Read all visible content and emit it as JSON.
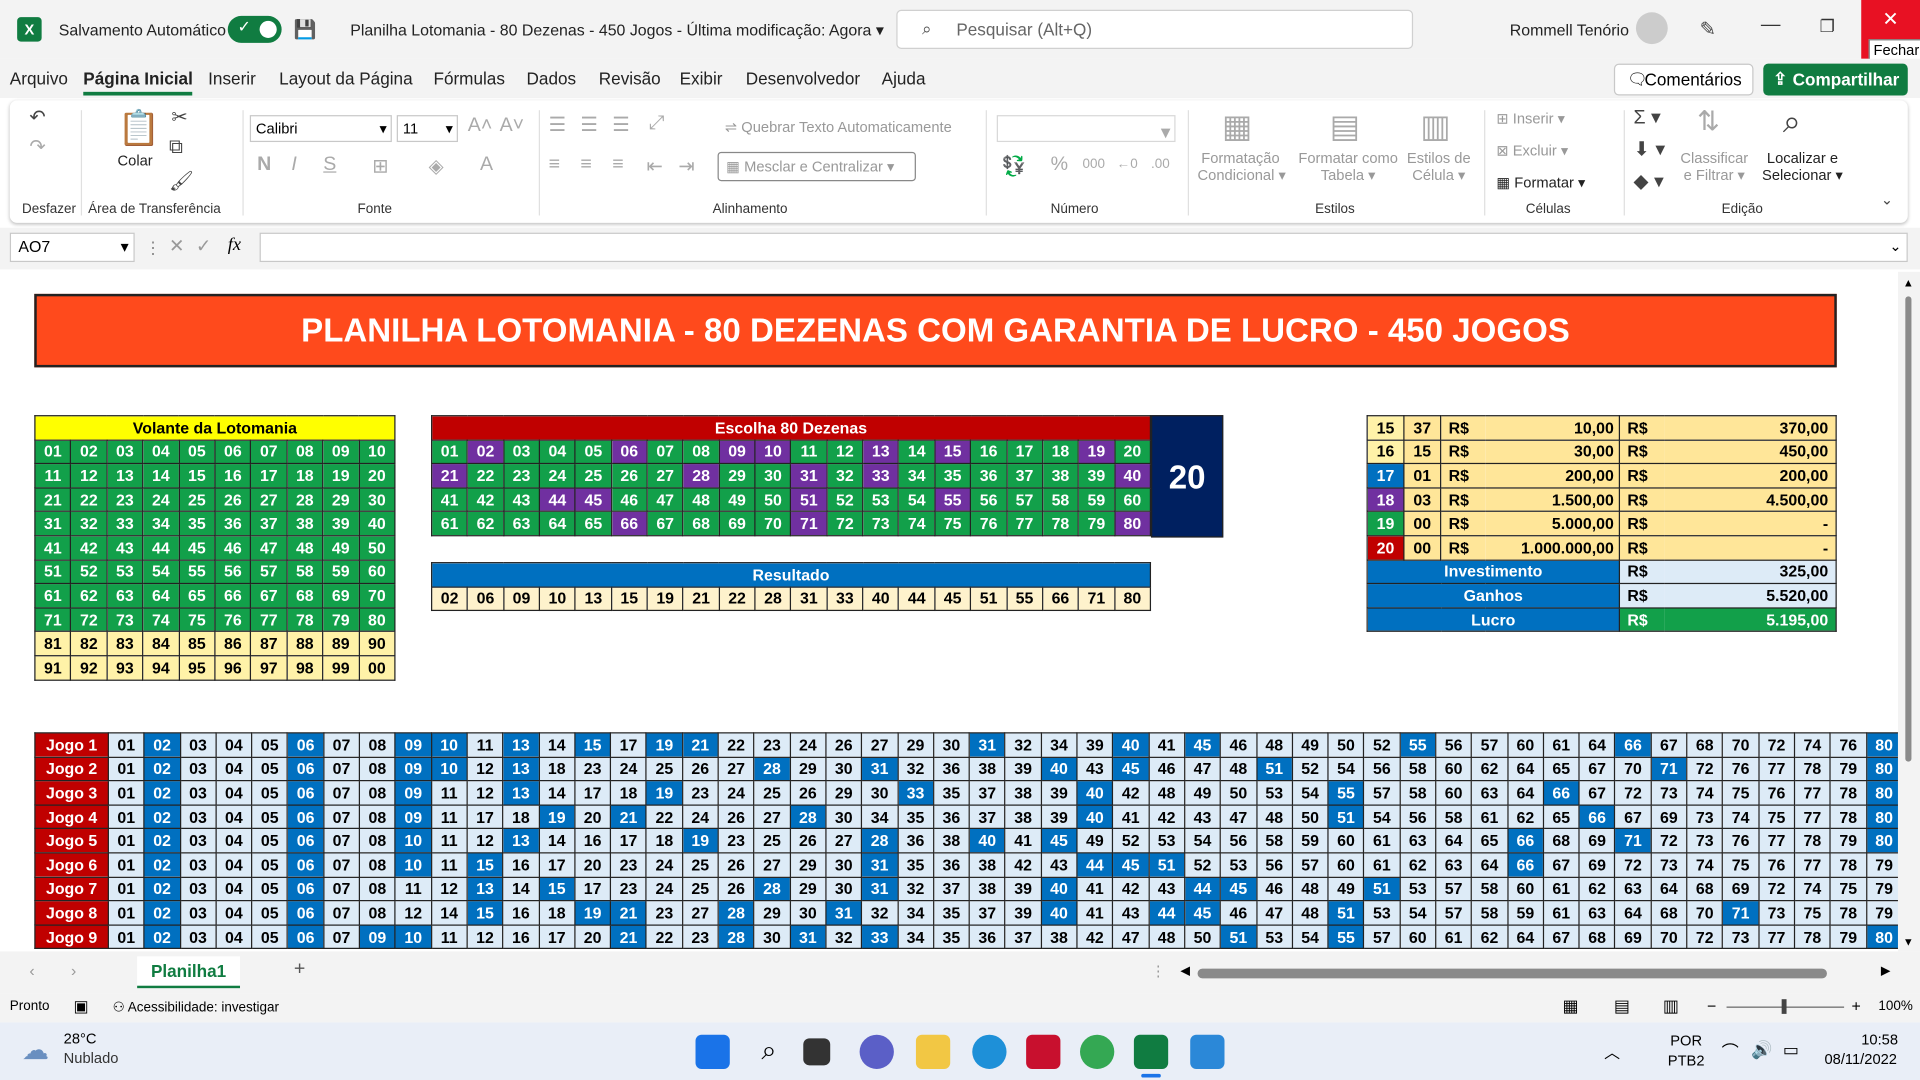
{
  "window": {
    "autosave_label": "Salvamento Automático",
    "file_title": "Planilha Lotomania - 80 Dezenas - 450 Jogos",
    "modified": "Última modificação: Agora",
    "search_placeholder": "Pesquisar (Alt+Q)",
    "user": "Rommell Tenório",
    "close_tooltip": "Fechar"
  },
  "menu": [
    "Arquivo",
    "Página Inicial",
    "Inserir",
    "Layout da Página",
    "Fórmulas",
    "Dados",
    "Revisão",
    "Exibir",
    "Desenvolvedor",
    "Ajuda"
  ],
  "comments_label": "Comentários",
  "share_label": "Compartilhar",
  "ribbon": {
    "paste": "Colar",
    "font_name": "Calibri",
    "font_size": "11",
    "wrap": "Quebrar Texto Automaticamente",
    "merge": "Mesclar e Centralizar",
    "cond_fmt_1": "Formatação",
    "cond_fmt_2": "Condicional",
    "fmt_table_1": "Formatar como",
    "fmt_table_2": "Tabela",
    "cell_styles_1": "Estilos de",
    "cell_styles_2": "Célula",
    "insert": "Inserir",
    "delete": "Excluir",
    "format": "Formatar",
    "sort_1": "Classificar",
    "sort_2": "e Filtrar",
    "find_1": "Localizar e",
    "find_2": "Selecionar",
    "groups": {
      "undo": "Desfazer",
      "clipboard": "Área de Transferência",
      "font": "Fonte",
      "align": "Alinhamento",
      "number": "Número",
      "styles": "Estilos",
      "cells": "Células",
      "edit": "Edição"
    }
  },
  "formula": {
    "namebox": "AO7",
    "fx": "fx"
  },
  "banner": "PLANILHA LOTOMANIA - 80 DEZENAS COM GARANTIA DE LUCRO - 450 JOGOS",
  "volante": {
    "title": "Volante da Lotomania",
    "rows": [
      [
        "01",
        "02",
        "03",
        "04",
        "05",
        "06",
        "07",
        "08",
        "09",
        "10"
      ],
      [
        "11",
        "12",
        "13",
        "14",
        "15",
        "16",
        "17",
        "18",
        "19",
        "20"
      ],
      [
        "21",
        "22",
        "23",
        "24",
        "25",
        "26",
        "27",
        "28",
        "29",
        "30"
      ],
      [
        "31",
        "32",
        "33",
        "34",
        "35",
        "36",
        "37",
        "38",
        "39",
        "40"
      ],
      [
        "41",
        "42",
        "43",
        "44",
        "45",
        "46",
        "47",
        "48",
        "49",
        "50"
      ],
      [
        "51",
        "52",
        "53",
        "54",
        "55",
        "56",
        "57",
        "58",
        "59",
        "60"
      ],
      [
        "61",
        "62",
        "63",
        "64",
        "65",
        "66",
        "67",
        "68",
        "69",
        "70"
      ],
      [
        "71",
        "72",
        "73",
        "74",
        "75",
        "76",
        "77",
        "78",
        "79",
        "80"
      ],
      [
        "81",
        "82",
        "83",
        "84",
        "85",
        "86",
        "87",
        "88",
        "89",
        "90"
      ],
      [
        "91",
        "92",
        "93",
        "94",
        "95",
        "96",
        "97",
        "98",
        "99",
        "00"
      ]
    ]
  },
  "escolha": {
    "title": "Escolha 80 Dezenas",
    "count": "20",
    "rows": [
      [
        "01",
        "02",
        "03",
        "04",
        "05",
        "06",
        "07",
        "08",
        "09",
        "10",
        "11",
        "12",
        "13",
        "14",
        "15",
        "16",
        "17",
        "18",
        "19",
        "20"
      ],
      [
        "21",
        "22",
        "23",
        "24",
        "25",
        "26",
        "27",
        "28",
        "29",
        "30",
        "31",
        "32",
        "33",
        "34",
        "35",
        "36",
        "37",
        "38",
        "39",
        "40"
      ],
      [
        "41",
        "42",
        "43",
        "44",
        "45",
        "46",
        "47",
        "48",
        "49",
        "50",
        "51",
        "52",
        "53",
        "54",
        "55",
        "56",
        "57",
        "58",
        "59",
        "60"
      ],
      [
        "61",
        "62",
        "63",
        "64",
        "65",
        "66",
        "67",
        "68",
        "69",
        "70",
        "71",
        "72",
        "73",
        "74",
        "75",
        "76",
        "77",
        "78",
        "79",
        "80"
      ]
    ],
    "highlight": [
      "02",
      "06",
      "09",
      "10",
      "13",
      "15",
      "19",
      "21",
      "28",
      "31",
      "33",
      "40",
      "44",
      "45",
      "51",
      "55",
      "66",
      "71",
      "80"
    ]
  },
  "resultado": {
    "title": "Resultado",
    "numbers": [
      "02",
      "06",
      "09",
      "10",
      "13",
      "15",
      "19",
      "21",
      "22",
      "28",
      "31",
      "33",
      "40",
      "44",
      "45",
      "51",
      "55",
      "66",
      "71",
      "80"
    ]
  },
  "premios": [
    {
      "pts": "15",
      "qty": "37",
      "cur1": "R$",
      "val": "10,00",
      "cur2": "R$",
      "total": "370,00",
      "c": "y"
    },
    {
      "pts": "16",
      "qty": "15",
      "cur1": "R$",
      "val": "30,00",
      "cur2": "R$",
      "total": "450,00",
      "c": "y"
    },
    {
      "pts": "17",
      "qty": "01",
      "cur1": "R$",
      "val": "200,00",
      "cur2": "R$",
      "total": "200,00",
      "c": "b"
    },
    {
      "pts": "18",
      "qty": "03",
      "cur1": "R$",
      "val": "1.500,00",
      "cur2": "R$",
      "total": "4.500,00",
      "c": "p"
    },
    {
      "pts": "19",
      "qty": "00",
      "cur1": "R$",
      "val": "5.000,00",
      "cur2": "R$",
      "total": "-",
      "c": "g"
    },
    {
      "pts": "20",
      "qty": "00",
      "cur1": "R$",
      "val": "1.000.000,00",
      "cur2": "R$",
      "total": "-",
      "c": "red"
    }
  ],
  "resumo": [
    {
      "label": "Investimento",
      "cur": "R$",
      "value": "325,00"
    },
    {
      "label": "Ganhos",
      "cur": "R$",
      "value": "5.520,00"
    },
    {
      "label": "Lucro",
      "cur": "R$",
      "value": "5.195,00"
    }
  ],
  "jogos": [
    {
      "label": "Jogo 1",
      "nums": [
        "01",
        "02",
        "03",
        "04",
        "05",
        "06",
        "07",
        "08",
        "09",
        "10",
        "11",
        "13",
        "14",
        "15",
        "17",
        "19",
        "21",
        "22",
        "23",
        "24",
        "26",
        "27",
        "29",
        "30",
        "31",
        "32",
        "34",
        "39",
        "40",
        "41",
        "45",
        "46",
        "48",
        "49",
        "50",
        "52",
        "55",
        "56",
        "57",
        "60",
        "61",
        "64",
        "66",
        "67",
        "68",
        "70",
        "72",
        "74",
        "76",
        "80"
      ]
    },
    {
      "label": "Jogo 2",
      "nums": [
        "01",
        "02",
        "03",
        "04",
        "05",
        "06",
        "07",
        "08",
        "09",
        "10",
        "12",
        "13",
        "18",
        "23",
        "24",
        "25",
        "26",
        "27",
        "28",
        "29",
        "30",
        "31",
        "32",
        "36",
        "38",
        "39",
        "40",
        "43",
        "45",
        "46",
        "47",
        "48",
        "51",
        "52",
        "54",
        "56",
        "58",
        "60",
        "62",
        "64",
        "65",
        "67",
        "70",
        "71",
        "72",
        "76",
        "77",
        "78",
        "79",
        "80"
      ]
    },
    {
      "label": "Jogo 3",
      "nums": [
        "01",
        "02",
        "03",
        "04",
        "05",
        "06",
        "07",
        "08",
        "09",
        "11",
        "12",
        "13",
        "14",
        "17",
        "18",
        "19",
        "23",
        "24",
        "25",
        "26",
        "29",
        "30",
        "33",
        "35",
        "37",
        "38",
        "39",
        "40",
        "42",
        "48",
        "49",
        "50",
        "53",
        "54",
        "55",
        "57",
        "58",
        "60",
        "63",
        "64",
        "66",
        "67",
        "72",
        "73",
        "74",
        "75",
        "76",
        "77",
        "78",
        "80"
      ]
    },
    {
      "label": "Jogo 4",
      "nums": [
        "01",
        "02",
        "03",
        "04",
        "05",
        "06",
        "07",
        "08",
        "09",
        "11",
        "17",
        "18",
        "19",
        "20",
        "21",
        "22",
        "24",
        "26",
        "27",
        "28",
        "30",
        "34",
        "35",
        "36",
        "37",
        "38",
        "39",
        "40",
        "41",
        "42",
        "43",
        "47",
        "48",
        "50",
        "51",
        "54",
        "56",
        "58",
        "61",
        "62",
        "65",
        "66",
        "67",
        "69",
        "73",
        "74",
        "75",
        "77",
        "78",
        "80"
      ]
    },
    {
      "label": "Jogo 5",
      "nums": [
        "01",
        "02",
        "03",
        "04",
        "05",
        "06",
        "07",
        "08",
        "10",
        "11",
        "12",
        "13",
        "14",
        "16",
        "17",
        "18",
        "19",
        "23",
        "25",
        "26",
        "27",
        "28",
        "36",
        "38",
        "40",
        "41",
        "45",
        "49",
        "52",
        "53",
        "54",
        "56",
        "58",
        "59",
        "60",
        "61",
        "63",
        "64",
        "65",
        "66",
        "68",
        "69",
        "71",
        "72",
        "73",
        "76",
        "77",
        "78",
        "79",
        "80"
      ]
    },
    {
      "label": "Jogo 6",
      "nums": [
        "01",
        "02",
        "03",
        "04",
        "05",
        "06",
        "07",
        "08",
        "10",
        "11",
        "15",
        "16",
        "17",
        "20",
        "23",
        "24",
        "25",
        "26",
        "27",
        "29",
        "30",
        "31",
        "35",
        "36",
        "38",
        "42",
        "43",
        "44",
        "45",
        "51",
        "52",
        "53",
        "56",
        "57",
        "60",
        "61",
        "62",
        "63",
        "64",
        "66",
        "67",
        "69",
        "72",
        "73",
        "74",
        "75",
        "76",
        "77",
        "78",
        "79"
      ]
    },
    {
      "label": "Jogo 7",
      "nums": [
        "01",
        "02",
        "03",
        "04",
        "05",
        "06",
        "07",
        "08",
        "11",
        "12",
        "13",
        "14",
        "15",
        "17",
        "23",
        "24",
        "25",
        "26",
        "28",
        "29",
        "30",
        "31",
        "32",
        "37",
        "38",
        "39",
        "40",
        "41",
        "42",
        "43",
        "44",
        "45",
        "46",
        "48",
        "49",
        "51",
        "53",
        "57",
        "58",
        "60",
        "61",
        "62",
        "63",
        "64",
        "68",
        "69",
        "72",
        "74",
        "75",
        "79"
      ]
    },
    {
      "label": "Jogo 8",
      "nums": [
        "01",
        "02",
        "03",
        "04",
        "05",
        "06",
        "07",
        "08",
        "12",
        "14",
        "15",
        "16",
        "18",
        "19",
        "21",
        "23",
        "27",
        "28",
        "29",
        "30",
        "31",
        "32",
        "34",
        "35",
        "37",
        "39",
        "40",
        "41",
        "43",
        "44",
        "45",
        "46",
        "47",
        "48",
        "51",
        "53",
        "54",
        "57",
        "58",
        "59",
        "61",
        "63",
        "64",
        "68",
        "70",
        "71",
        "73",
        "75",
        "78",
        "79"
      ]
    },
    {
      "label": "Jogo 9",
      "nums": [
        "01",
        "02",
        "03",
        "04",
        "05",
        "06",
        "07",
        "09",
        "10",
        "11",
        "12",
        "16",
        "17",
        "20",
        "21",
        "22",
        "23",
        "28",
        "30",
        "31",
        "32",
        "33",
        "34",
        "35",
        "36",
        "37",
        "38",
        "42",
        "47",
        "48",
        "50",
        "51",
        "53",
        "54",
        "55",
        "57",
        "60",
        "61",
        "62",
        "64",
        "67",
        "68",
        "69",
        "70",
        "72",
        "73",
        "77",
        "78",
        "79",
        "80"
      ]
    }
  ],
  "sheet_tab": "Planilha1",
  "status": {
    "ready": "Pronto",
    "accessibility": "Acessibilidade: investigar",
    "zoom": "100%"
  },
  "taskbar": {
    "temp": "28°C",
    "weather": "Nublado",
    "lang1": "POR",
    "lang2": "PTB2",
    "time": "10:58",
    "date": "08/11/2022"
  },
  "colors": {
    "excel_green": "#107c41",
    "banner": "#ff4a1c",
    "green": "#12a04a",
    "purple": "#7030a0",
    "blue": "#0070c0",
    "red": "#c00000",
    "yellow_header": "#ffff00",
    "navy": "#002060"
  }
}
